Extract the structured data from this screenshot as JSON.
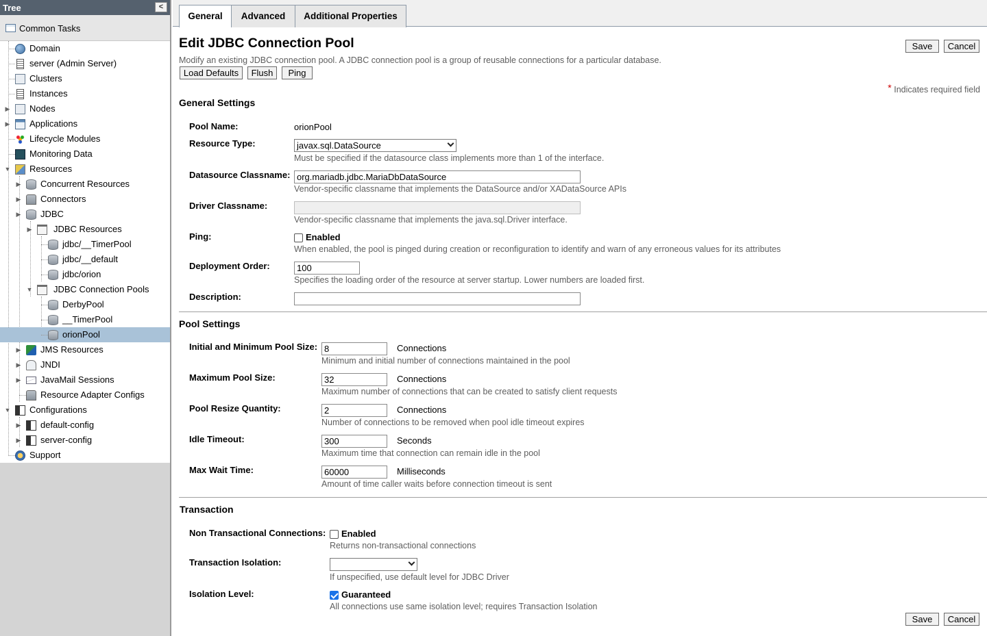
{
  "tree": {
    "header": "Tree",
    "collapse_glyph": "<",
    "common_tasks": "Common Tasks",
    "items": [
      {
        "label": "Domain",
        "icon": "globe-icon"
      },
      {
        "label": "server (Admin Server)",
        "icon": "server-icon"
      },
      {
        "label": "Clusters",
        "icon": "cluster-icon"
      },
      {
        "label": "Instances",
        "icon": "server-icon"
      },
      {
        "label": "Nodes",
        "icon": "node-icon",
        "expander": "collapsed"
      },
      {
        "label": "Applications",
        "icon": "applications-icon",
        "expander": "collapsed"
      },
      {
        "label": "Lifecycle Modules",
        "icon": "lifecycle-icon"
      },
      {
        "label": "Monitoring Data",
        "icon": "monitor-icon"
      },
      {
        "label": "Resources",
        "icon": "resources-icon",
        "expander": "expanded"
      },
      {
        "label": "Concurrent Resources",
        "icon": "database-icon",
        "expander": "collapsed"
      },
      {
        "label": "Connectors",
        "icon": "connector-icon",
        "expander": "collapsed"
      },
      {
        "label": "JDBC",
        "icon": "database-icon",
        "expander": "expanded"
      },
      {
        "label": "JDBC Resources",
        "icon": "folder-icon",
        "expander": "collapsed"
      },
      {
        "label": "jdbc/__TimerPool",
        "icon": "database-icon"
      },
      {
        "label": "jdbc/__default",
        "icon": "database-icon"
      },
      {
        "label": "jdbc/orion",
        "icon": "database-icon"
      },
      {
        "label": "JDBC Connection Pools",
        "icon": "folder-icon",
        "expander": "expanded"
      },
      {
        "label": "DerbyPool",
        "icon": "database-icon"
      },
      {
        "label": "__TimerPool",
        "icon": "database-icon"
      },
      {
        "label": "orionPool",
        "icon": "database-icon",
        "selected": true
      },
      {
        "label": "JMS Resources",
        "icon": "jms-icon",
        "expander": "collapsed"
      },
      {
        "label": "JNDI",
        "icon": "jndi-icon",
        "expander": "collapsed"
      },
      {
        "label": "JavaMail Sessions",
        "icon": "mail-icon",
        "expander": "collapsed"
      },
      {
        "label": "Resource Adapter Configs",
        "icon": "connector-icon"
      },
      {
        "label": "Configurations",
        "icon": "configuration-icon",
        "expander": "expanded"
      },
      {
        "label": "default-config",
        "icon": "configuration-icon",
        "expander": "collapsed"
      },
      {
        "label": "server-config",
        "icon": "configuration-icon",
        "expander": "collapsed"
      },
      {
        "label": "Support",
        "icon": "support-icon"
      }
    ]
  },
  "tabs": [
    {
      "label": "General",
      "active": true
    },
    {
      "label": "Advanced",
      "active": false
    },
    {
      "label": "Additional Properties",
      "active": false
    }
  ],
  "page": {
    "title": "Edit JDBC Connection Pool",
    "help": "Modify an existing JDBC connection pool. A JDBC connection pool is a group of reusable connections for a particular database.",
    "save": "Save",
    "cancel": "Cancel",
    "load_defaults": "Load Defaults",
    "flush": "Flush",
    "ping": "Ping",
    "required_star": "*",
    "required_note": "Indicates required field"
  },
  "general": {
    "title": "General Settings",
    "pool_name_label": "Pool Name:",
    "pool_name": "orionPool",
    "resource_type_label": "Resource Type:",
    "resource_type": "javax.sql.DataSource",
    "resource_type_help": "Must be specified if the datasource class implements more than 1 of the interface.",
    "ds_classname_label": "Datasource Classname:",
    "ds_classname": "org.mariadb.jdbc.MariaDbDataSource",
    "ds_classname_help": "Vendor-specific classname that implements the DataSource and/or XADataSource APIs",
    "driver_classname_label": "Driver Classname:",
    "driver_classname": "",
    "driver_classname_help": "Vendor-specific classname that implements the java.sql.Driver interface.",
    "ping_label": "Ping:",
    "ping_enabled_label": "Enabled",
    "ping_enabled": false,
    "ping_help": "When enabled, the pool is pinged during creation or reconfiguration to identify and warn of any erroneous values for its attributes",
    "deploy_order_label": "Deployment Order:",
    "deploy_order": "100",
    "deploy_order_help": "Specifies the loading order of the resource at server startup. Lower numbers are loaded first.",
    "description_label": "Description:",
    "description": ""
  },
  "pool": {
    "title": "Pool Settings",
    "initial_label": "Initial and Minimum Pool Size:",
    "initial": "8",
    "initial_unit": "Connections",
    "initial_help": "Minimum and initial number of connections maintained in the pool",
    "max_label": "Maximum Pool Size:",
    "max": "32",
    "max_unit": "Connections",
    "max_help": "Maximum number of connections that can be created to satisfy client requests",
    "resize_label": "Pool Resize Quantity:",
    "resize": "2",
    "resize_unit": "Connections",
    "resize_help": "Number of connections to be removed when pool idle timeout expires",
    "idle_label": "Idle Timeout:",
    "idle": "300",
    "idle_unit": "Seconds",
    "idle_help": "Maximum time that connection can remain idle in the pool",
    "wait_label": "Max Wait Time:",
    "wait": "60000",
    "wait_unit": "Milliseconds",
    "wait_help": "Amount of time caller waits before connection timeout is sent"
  },
  "transaction": {
    "title": "Transaction",
    "non_tx_label": "Non Transactional Connections:",
    "non_tx_enabled_label": "Enabled",
    "non_tx_enabled": false,
    "non_tx_help": "Returns non-transactional connections",
    "isolation_label": "Transaction Isolation:",
    "isolation": "",
    "isolation_help": "If unspecified, use default level for JDBC Driver",
    "level_label": "Isolation Level:",
    "level_guaranteed_label": "Guaranteed",
    "level_guaranteed": true,
    "level_help": "All connections use same isolation level; requires Transaction Isolation"
  }
}
